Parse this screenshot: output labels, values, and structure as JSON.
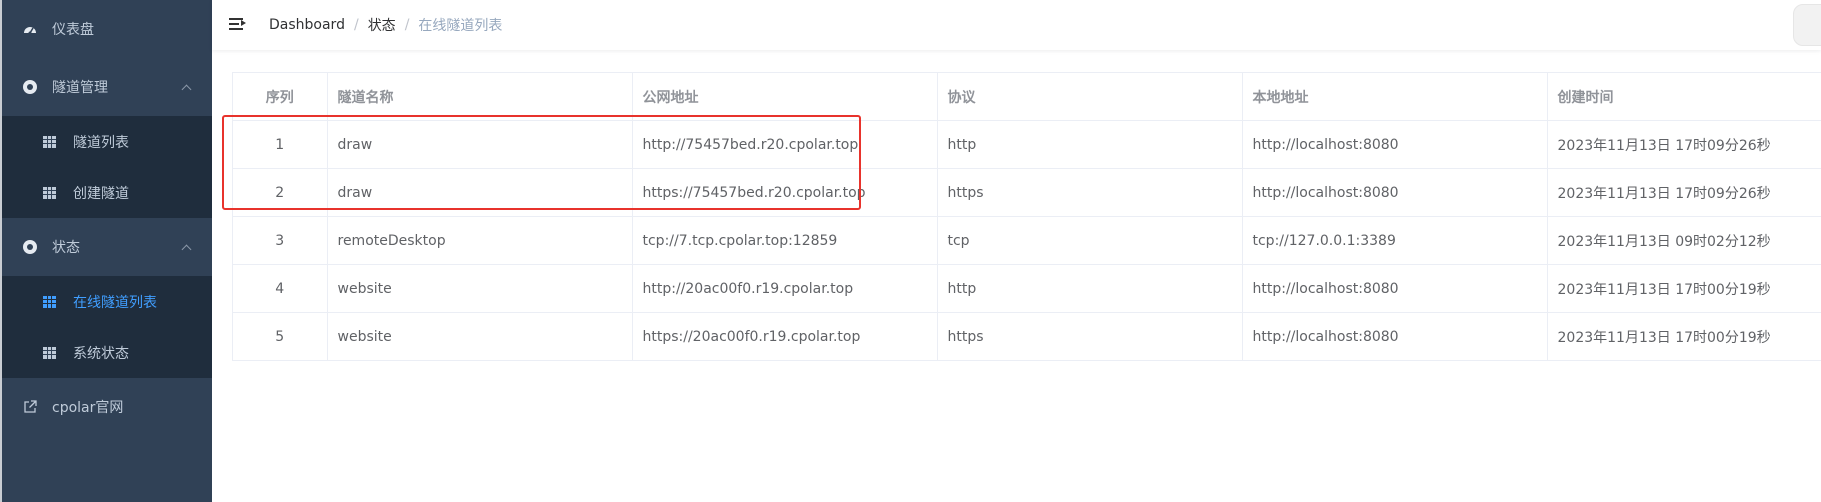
{
  "sidebar": {
    "items": [
      {
        "label": "仪表盘",
        "icon": "dashboard-icon"
      },
      {
        "label": "隧道管理",
        "icon": "circle-icon",
        "children": [
          {
            "label": "隧道列表",
            "icon": "grid-icon"
          },
          {
            "label": "创建隧道",
            "icon": "grid-icon"
          }
        ]
      },
      {
        "label": "状态",
        "icon": "circle-icon",
        "children": [
          {
            "label": "在线隧道列表",
            "icon": "grid-icon",
            "active": true
          },
          {
            "label": "系统状态",
            "icon": "grid-icon"
          }
        ]
      },
      {
        "label": "cpolar官网",
        "icon": "external-link-icon"
      }
    ]
  },
  "breadcrumb": [
    "Dashboard",
    "状态",
    "在线隧道列表"
  ],
  "table": {
    "headers": [
      "序列",
      "隧道名称",
      "公网地址",
      "协议",
      "本地地址",
      "创建时间"
    ],
    "rows": [
      [
        "1",
        "draw",
        "http://75457bed.r20.cpolar.top",
        "http",
        "http://localhost:8080",
        "2023年11月13日 17时09分26秒"
      ],
      [
        "2",
        "draw",
        "https://75457bed.r20.cpolar.top",
        "https",
        "http://localhost:8080",
        "2023年11月13日 17时09分26秒"
      ],
      [
        "3",
        "remoteDesktop",
        "tcp://7.tcp.cpolar.top:12859",
        "tcp",
        "tcp://127.0.0.1:3389",
        "2023年11月13日 09时02分12秒"
      ],
      [
        "4",
        "website",
        "http://20ac00f0.r19.cpolar.top",
        "http",
        "http://localhost:8080",
        "2023年11月13日 17时00分19秒"
      ],
      [
        "5",
        "website",
        "https://20ac00f0.r19.cpolar.top",
        "https",
        "http://localhost:8080",
        "2023年11月13日 17时00分19秒"
      ]
    ]
  },
  "colors": {
    "sidebar_bg": "#304156",
    "submenu_bg": "#1f2d3d",
    "active": "#409eff",
    "highlight": "#e8332c"
  }
}
